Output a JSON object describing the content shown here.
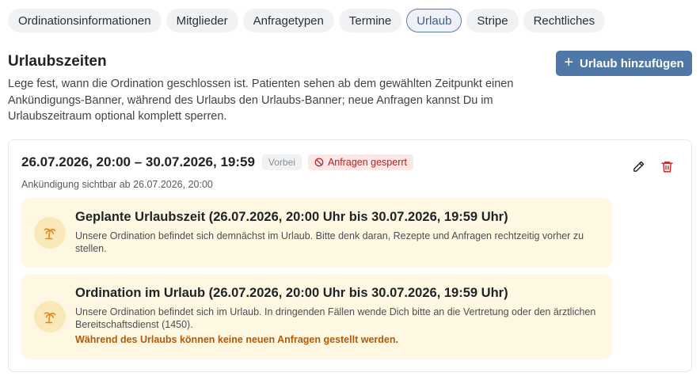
{
  "tabs": [
    {
      "label": "Ordinationsinformationen",
      "active": false
    },
    {
      "label": "Mitglieder",
      "active": false
    },
    {
      "label": "Anfragetypen",
      "active": false
    },
    {
      "label": "Termine",
      "active": false
    },
    {
      "label": "Urlaub",
      "active": true
    },
    {
      "label": "Stripe",
      "active": false
    },
    {
      "label": "Rechtliches",
      "active": false
    }
  ],
  "section": {
    "title": "Urlaubszeiten",
    "description": "Lege fest, wann die Ordination geschlossen ist. Patienten sehen ab dem gewählten Zeitpunkt einen Ankündigungs-Banner, während des Urlaubs den Urlaubs-Banner; neue Anfragen kannst Du im Urlaubszeitraum optional komplett sperren.",
    "add_button": "Urlaub hinzufügen"
  },
  "vacation": {
    "range": "26.07.2026, 20:00 – 30.07.2026, 19:59",
    "status_badge": "Vorbei",
    "locked_badge": "Anfragen gesperrt",
    "announcement": "Ankündigung sichtbar ab 26.07.2026, 20:00",
    "banner_planned": {
      "title": "Geplante Urlaubszeit (26.07.2026, 20:00 Uhr bis 30.07.2026, 19:59 Uhr)",
      "text": "Unsere Ordination befindet sich demnächst im Urlaub. Bitte denk daran, Rezepte und Anfragen rechtzeitig vorher zu stellen."
    },
    "banner_active": {
      "title": "Ordination im Urlaub (26.07.2026, 20:00 Uhr bis 30.07.2026, 19:59 Uhr)",
      "text": "Unsere Ordination befindet sich im Urlaub. In dringenden Fällen wende Dich bitte an die Vertretung oder den ärztlichen Bereitschaftsdienst (1450).",
      "warning": "Während des Urlaubs können keine neuen Anfragen gestellt werden."
    }
  },
  "icons": {
    "add": "plus-icon",
    "edit": "pencil-icon",
    "delete": "trash-icon",
    "locked": "ban-icon",
    "banner": "palm-tree-icon"
  },
  "colors": {
    "accent": "#4f78a6",
    "danger": "#c62828",
    "banner_bg": "#fef8e2",
    "banner_icon": "#e08a1e",
    "warning_text": "#b35a0a"
  }
}
